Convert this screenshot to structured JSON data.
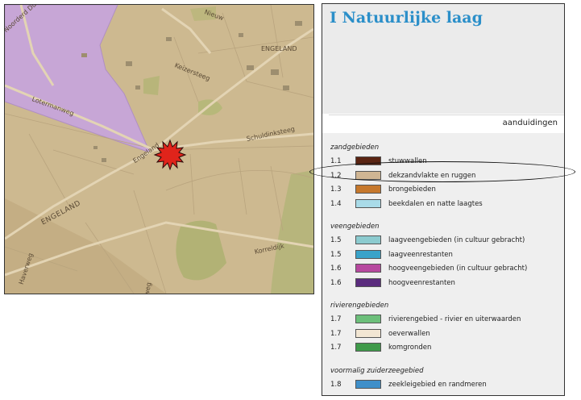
{
  "map": {
    "streets": {
      "noorderd": "Noorderd Dukatonweg",
      "lotermanweg": "Lotermanweg",
      "keizersteeg": "Keizersteeg",
      "engeland_top": "ENGELAND",
      "nieuw": "Nieuw",
      "schuldinksteeg": "Schuldinksteeg",
      "engeland_mid": "Engeland",
      "engeland_big": "ENGELAND",
      "haverweg": "Haverweg",
      "korreldijk": "Korreldijk",
      "sweg": "weg"
    },
    "colors": {
      "land": "#cdb990",
      "zone": "#c9a7d9",
      "marker": "#e0241b"
    },
    "marker_icon": "red-star-icon"
  },
  "legend": {
    "title": "I Natuurlijke laag",
    "tab_label": "aanduidingen",
    "sections": [
      {
        "name": "zandgebieden",
        "items": [
          {
            "code": "1.1",
            "label": "stuwwallen",
            "color": "#5a2412"
          },
          {
            "code": "1.2",
            "label": "dekzandvlakte en ruggen",
            "color": "#cfb593"
          },
          {
            "code": "1.3",
            "label": "brongebieden",
            "color": "#c6782c"
          },
          {
            "code": "1.4",
            "label": "beekdalen en natte laagtes",
            "color": "#a9dbe8"
          }
        ]
      },
      {
        "name": "veengebieden",
        "items": [
          {
            "code": "1.5",
            "label": "laagveengebieden (in cultuur gebracht)",
            "color": "#8ccbcf"
          },
          {
            "code": "1.5",
            "label": "laagveenrestanten",
            "color": "#3aa3c9"
          },
          {
            "code": "1.6",
            "label": "hoogveengebieden (in cultuur gebracht)",
            "color": "#b7489f"
          },
          {
            "code": "1.6",
            "label": "hoogveenrestanten",
            "color": "#5a2b7d"
          }
        ]
      },
      {
        "name": "rivierengebieden",
        "items": [
          {
            "code": "1.7",
            "label": "rivierengebied - rivier en uiterwaarden",
            "color": "#6cbf7a"
          },
          {
            "code": "1.7",
            "label": "oeverwallen",
            "color": "#f2e6d3"
          },
          {
            "code": "1.7",
            "label": "komgronden",
            "color": "#3f9a4a"
          }
        ]
      },
      {
        "name": "voormalig zuiderzeegebied",
        "items": [
          {
            "code": "1.8",
            "label": "zeekleigebied en randmeren",
            "color": "#3f8fc9"
          }
        ]
      }
    ],
    "highlighted_item": "dekzandvlakte en ruggen"
  }
}
